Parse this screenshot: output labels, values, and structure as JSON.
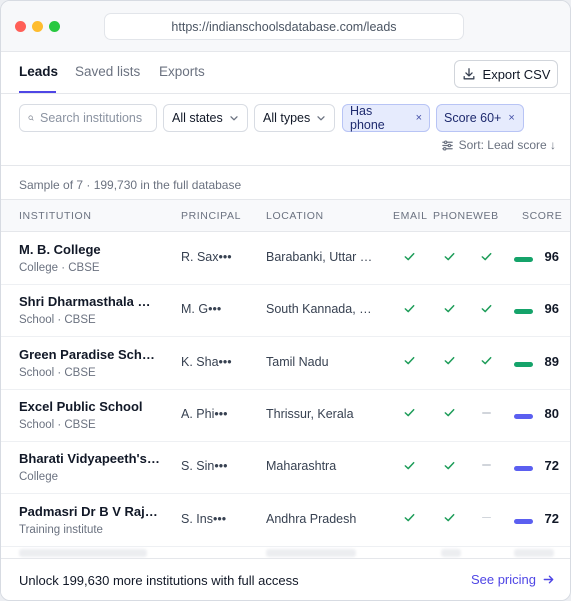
{
  "browser": {
    "url": "https://indianschoolsdatabase.com/leads"
  },
  "tabs": [
    {
      "label": "Leads",
      "active": true
    },
    {
      "label": "Saved lists",
      "active": false
    },
    {
      "label": "Exports",
      "active": false
    }
  ],
  "toolbar": {
    "export_label": "Export CSV",
    "export_icon": "download-icon"
  },
  "filters": {
    "search_placeholder": "Search institutions",
    "states_label": "All states",
    "types_label": "All types",
    "chips": [
      {
        "label": "Has phone",
        "remove": "×"
      },
      {
        "label": "Score 60+",
        "remove": "×"
      }
    ],
    "sort_label": "Sort: Lead score ↓"
  },
  "summary": "Sample of 7 · 199,730 in the full database",
  "table": {
    "headers": {
      "institution": "Institution",
      "principal": "Principal",
      "location": "Location",
      "email": "Email",
      "phone": "Phone",
      "web": "Web",
      "score": "Score"
    },
    "rows": [
      {
        "name": "M. B. College",
        "type": "College · CBSE",
        "principal": "R. Sax•••",
        "location": "Barabanki, Uttar Pradesh",
        "email": true,
        "phone": true,
        "web": true,
        "score": 96,
        "bar_color": "#15a36a"
      },
      {
        "name": "Shri Dharmasthala Manjunatheshwara",
        "type": "School · CBSE",
        "principal": "M. G•••",
        "location": "South Kannada, Karnataka",
        "email": true,
        "phone": true,
        "web": true,
        "score": 96,
        "bar_color": "#15a36a"
      },
      {
        "name": "Green Paradise School",
        "type": "School · CBSE",
        "principal": "K. Sha•••",
        "location": "Tamil Nadu",
        "email": true,
        "phone": true,
        "web": true,
        "score": 89,
        "bar_color": "#15a36a"
      },
      {
        "name": "Excel Public School",
        "type": "School · CBSE",
        "principal": "A. Phi•••",
        "location": "Thrissur, Kerala",
        "email": true,
        "phone": true,
        "web": false,
        "score": 80,
        "bar_color": "#5b5ff0"
      },
      {
        "name": "Bharati Vidyapeeth's College",
        "type": "College",
        "principal": "S. Sin•••",
        "location": "Maharashtra",
        "email": true,
        "phone": true,
        "web": false,
        "score": 72,
        "bar_color": "#5b5ff0"
      },
      {
        "name": "Padmasri Dr B V Raju Institute",
        "type": "Training institute",
        "principal": "S. Ins•••",
        "location": "Andhra Pradesh",
        "email": true,
        "phone": true,
        "web": false,
        "score": 72,
        "bar_color": "#5b5ff0"
      }
    ]
  },
  "footer": {
    "text": "Unlock 199,630 more institutions with full access",
    "cta": "See pricing",
    "cta_icon": "arrow-right-icon"
  },
  "colors": {
    "accent": "#4f46e5",
    "check": "#1f9d5a",
    "chip_bg": "#e6ebfd"
  }
}
